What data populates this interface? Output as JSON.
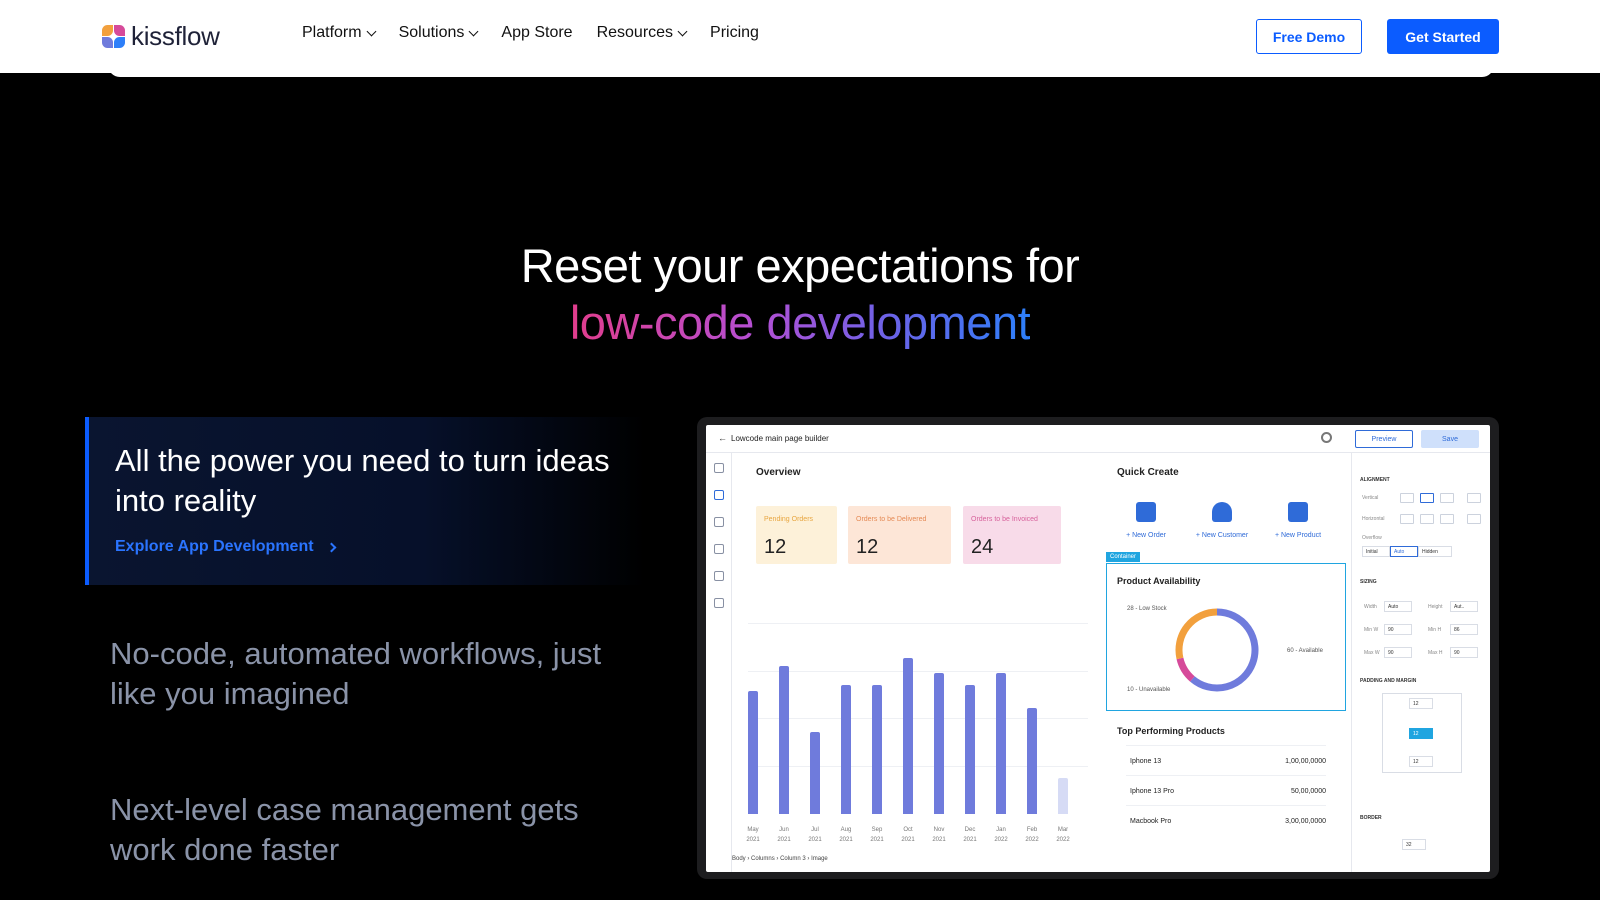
{
  "header": {
    "logo_text": "kissflow",
    "nav": [
      {
        "label": "Platform",
        "has_dropdown": true
      },
      {
        "label": "Solutions",
        "has_dropdown": true
      },
      {
        "label": "App Store",
        "has_dropdown": false
      },
      {
        "label": "Resources",
        "has_dropdown": true
      },
      {
        "label": "Pricing",
        "has_dropdown": false
      }
    ],
    "free_demo": "Free Demo",
    "get_started": "Get Started"
  },
  "hero": {
    "line1": "Reset your expectations for",
    "line2": "low-code development"
  },
  "features": {
    "active_title": "All the power you need to turn ideas into reality",
    "active_link": "Explore App Development",
    "item2": "No-code, automated workflows, just like you imagined",
    "item3": "Next-level case management gets work done faster"
  },
  "mock": {
    "title": "Lowcode main page builder",
    "preview": "Preview",
    "save": "Save",
    "overview": "Overview",
    "kpis": [
      {
        "label": "Pending Orders",
        "value": "12",
        "bg": "#fdf1d9",
        "fg": "#e8a640"
      },
      {
        "label": "Orders to be Delivered",
        "value": "12",
        "bg": "#fde6d7",
        "fg": "#e58a55"
      },
      {
        "label": "Orders to be Invoiced",
        "value": "24",
        "bg": "#f8dbe9",
        "fg": "#d7629c"
      }
    ],
    "chart_data": {
      "type": "bar",
      "categories": [
        "May 2021",
        "Jun 2021",
        "Jul 2021",
        "Aug 2021",
        "Sep 2021",
        "Oct 2021",
        "Nov 2021",
        "Dec 2021",
        "Jan 2022",
        "Feb 2022",
        "Mar 2022"
      ],
      "month_labels": [
        "May",
        "Jun",
        "Jul",
        "Aug",
        "Sep",
        "Oct",
        "Nov",
        "Dec",
        "Jan",
        "Feb",
        "Mar"
      ],
      "year_labels": [
        "2021",
        "2021",
        "2021",
        "2021",
        "2021",
        "2021",
        "2021",
        "2021",
        "2022",
        "2022",
        "2022"
      ],
      "values": [
        65,
        78,
        43,
        68,
        68,
        82,
        74,
        68,
        74,
        56,
        19
      ],
      "colors": [
        "#6f7bdc",
        "#6f7bdc",
        "#6f7bdc",
        "#6f7bdc",
        "#6f7bdc",
        "#6f7bdc",
        "#6f7bdc",
        "#6f7bdc",
        "#6f7bdc",
        "#6f7bdc",
        "#d6dbf5"
      ],
      "ylim": [
        0,
        100
      ]
    },
    "quick_create": "Quick Create",
    "quick_items": [
      "+ New Order",
      "+ New Customer",
      "+ New Product"
    ],
    "container_tag": "Container",
    "product_availability": "Product Availability",
    "donut_chart_data": {
      "type": "pie",
      "categories": [
        "Low Stock",
        "Available",
        "Unavailable"
      ],
      "values": [
        28,
        60,
        10
      ],
      "colors": [
        "#f2a03d",
        "#6f7bdc",
        "#d64a9a"
      ],
      "legend": [
        "28 - Low Stock",
        "60 - Available",
        "10 - Unavailable"
      ]
    },
    "top_products": "Top Performing Products",
    "products": [
      {
        "name": "Iphone 13",
        "value": "1,00,00,0000"
      },
      {
        "name": "Iphone 13 Pro",
        "value": "50,00,0000"
      },
      {
        "name": "Macbook Pro",
        "value": "3,00,00,0000"
      }
    ],
    "right_panel": {
      "alignment": "ALIGNMENT",
      "vertical": "Vertical",
      "horizontal": "Horizontal",
      "overflow": "Overflow",
      "overflow_opts": [
        "Initial",
        "Auto",
        "Hidden"
      ],
      "sizing": "SIZING",
      "width_l": "Width",
      "width_v": "Auto",
      "height_l": "Height",
      "height_v": "Aut..",
      "minw_l": "Min W",
      "minw_v": "90",
      "minh_l": "Min H",
      "minh_v": "86",
      "maxw_l": "Max W",
      "maxw_v": "90",
      "maxh_l": "Max H",
      "maxh_v": "90",
      "padding": "PADDING AND MARGIN",
      "pad_val": "12",
      "border": "BORDER",
      "border_val": "32",
      "unit": "px"
    },
    "breadcrumb": [
      "Body",
      "Columns",
      "Column 3",
      "Image"
    ]
  }
}
